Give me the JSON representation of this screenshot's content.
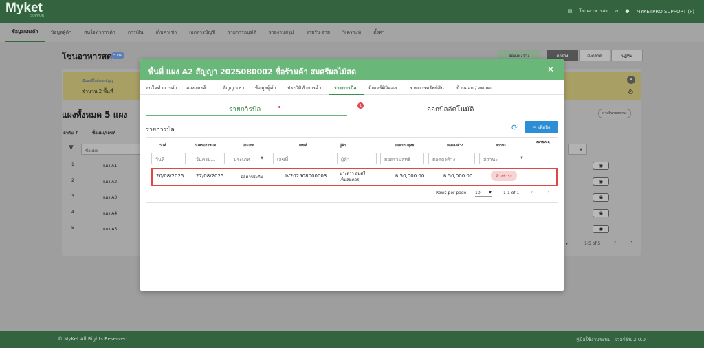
{
  "app": {
    "logo": "Myket",
    "logo_sub": "SUPPORT"
  },
  "topbar": {
    "store": "โซนอาหารสด",
    "user": "MYKETPRO SUPPORT (P)",
    "store_icon": "store-icon",
    "home_icon": "home-icon",
    "user_icon": "user-icon"
  },
  "nav": [
    "ข้อมูลแผงค้า",
    "ข้อมูลผู้ค้า",
    "สนใจทำการค้า",
    "การเงิน",
    "เก็บค่าเช่า",
    "เอกสารบัญชี",
    "รายการอนุมัติ",
    "รายงานสรุป",
    "รายรับ-จ่าย",
    "วิเคราะห์",
    "ตั้งค่า"
  ],
  "background": {
    "title": "โซนอาหารสด",
    "badge": "5 แผง",
    "btn_book": "จองแผงว่าง",
    "view_tabs": [
      "ตาราง",
      "ผังตลาด",
      "ปฏิทิน"
    ],
    "banner_line1": "มีแผงที่ใกล้หมดสัญญา",
    "banner_line2": "จำนวน 2 พื้นที่",
    "count_title": "แผงทั้งหมด 5 แผง",
    "help": "คำอธิบายสถานะ",
    "col_order": "ลำดับ ↑",
    "col_name": "ชื่อแผง/เลขที่",
    "filter_placeholder": "ชื่อแผง",
    "rows": [
      {
        "num": "1",
        "name": "แผง A1"
      },
      {
        "num": "2",
        "name": "แผง A2"
      },
      {
        "num": "3",
        "name": "แผง A3"
      },
      {
        "num": "4",
        "name": "แผง A4"
      },
      {
        "num": "5",
        "name": "แผง A5"
      }
    ],
    "pagination": "1-5 of 5"
  },
  "footer": {
    "left": "© MyKet All Rights Reserved",
    "right": "คู่มือใช้งานระบบ | เวอร์ชัน 2.0.0"
  },
  "modal": {
    "title": "พื้นที่ แผง A2 สัญญา 2025080002 ชื่อร้านค้า สมศรีผลไม้สด",
    "close": "✕",
    "tabs": [
      "สนใจทำการค้า",
      "จองแผงค้า",
      "สัญญาเช่า",
      "ข้อมูลผู้ค้า",
      "ประวัติทำการค้า",
      "รายการบิล",
      "มิเตอร์ดิจิตอล",
      "รายการทรัพย์สิน",
      "ย้ายออก / ลดแผง"
    ],
    "notif_count": "1",
    "subtabs": [
      "รายการบิล",
      "ออกบิลอัตโนมัติ"
    ],
    "section_title": "รายการบิล",
    "add_button": "เพิ่มบิล",
    "columns": [
      "วันที่",
      "วันครบกำหนด",
      "ประเภท",
      "เลขที่",
      "ผู้ค้า",
      "ยอดรวมสุทธิ",
      "ยอดคงค้าง",
      "สถานะ",
      "หมายเหตุ"
    ],
    "filters": [
      "วันที่",
      "วันครบ...",
      "ประเภท",
      "เลขที่",
      "ผู้ค้า",
      "ยอดรวมสุทธิ",
      "ยอดคงค้าง",
      "สถานะ"
    ],
    "row": {
      "date": "20/08/2025",
      "due": "27/08/2025",
      "type": "บิลค่าประกัน",
      "number": "IV202508000003",
      "vendor_line1": "นางสาว สมศรี",
      "vendor_line2": "เห็นสมควร",
      "total": "฿ 50,000.00",
      "outstanding": "฿ 50,000.00",
      "status": "ค้างชำระ"
    },
    "pagination": {
      "label": "Rows per page:",
      "per_page": "10",
      "range": "1-1 of 1"
    }
  }
}
